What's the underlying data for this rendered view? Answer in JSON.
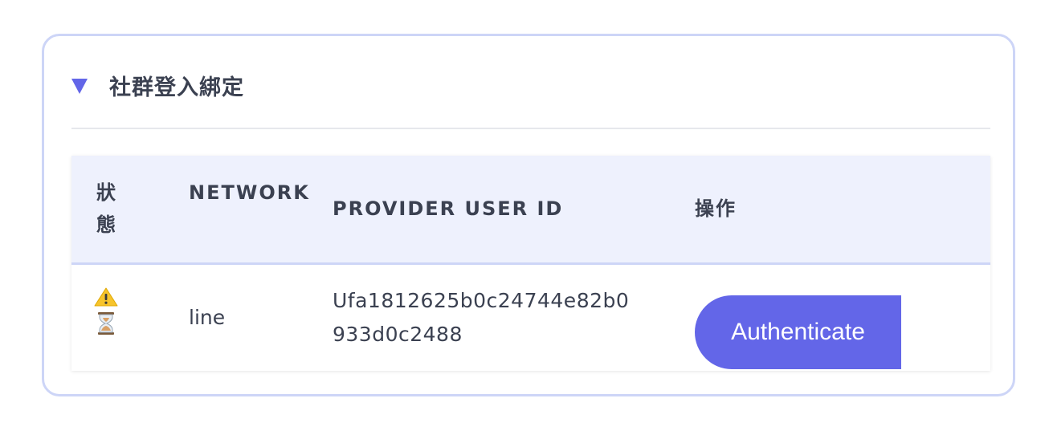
{
  "section": {
    "title": "社群登入綁定",
    "expand_icon": "triangle-down-icon",
    "accent_color": "#6366e8",
    "border_color": "#cdd5f7"
  },
  "table": {
    "headers": {
      "status": "狀態",
      "network": "NETWORK",
      "provider_user_id": "PROVIDER USER ID",
      "action": "操作"
    },
    "rows": [
      {
        "status_icons": [
          "warning-icon",
          "hourglass-icon"
        ],
        "network": "line",
        "provider_user_id": "Ufa1812625b0c24744e82b0933d0c2488",
        "action_label": "Authenticate"
      }
    ]
  }
}
